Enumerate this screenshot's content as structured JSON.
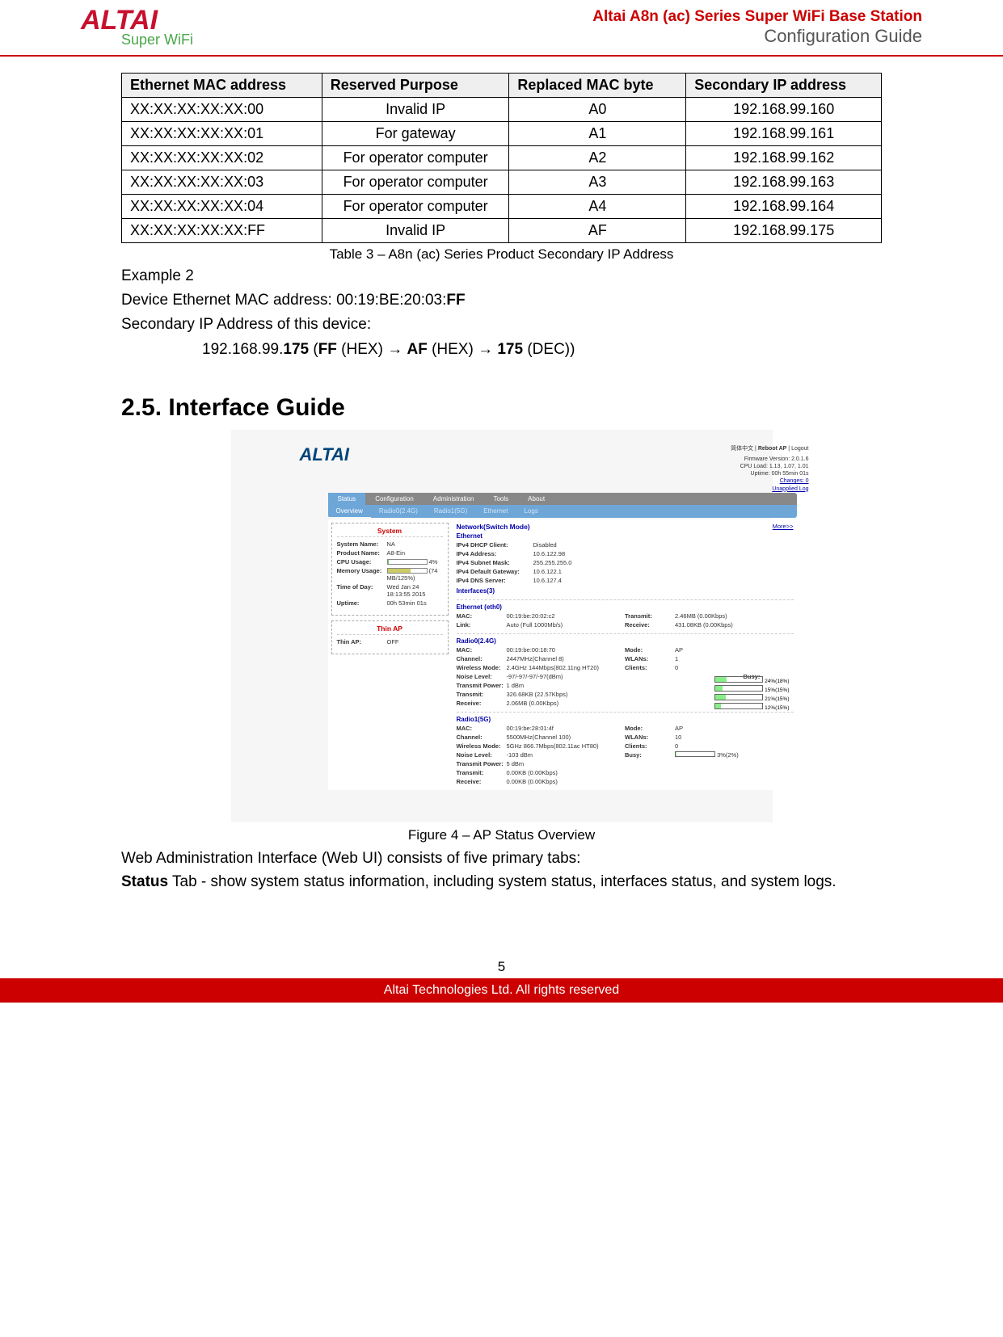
{
  "header": {
    "logo_text": "ALTAI",
    "logo_sub": "Super WiFi",
    "title_line1": "Altai A8n (ac) Series Super WiFi Base Station",
    "title_line2": "Configuration Guide"
  },
  "table3": {
    "headers": [
      "Ethernet MAC address",
      "Reserved Purpose",
      "Replaced MAC byte",
      "Secondary IP address"
    ],
    "rows": [
      {
        "mac": "XX:XX:XX:XX:XX:00",
        "purpose": "Invalid IP",
        "byte": "A0",
        "ip": "192.168.99.160"
      },
      {
        "mac": "XX:XX:XX:XX:XX:01",
        "purpose": "For gateway",
        "byte": "A1",
        "ip": "192.168.99.161"
      },
      {
        "mac": "XX:XX:XX:XX:XX:02",
        "purpose": "For operator computer",
        "byte": "A2",
        "ip": "192.168.99.162"
      },
      {
        "mac": "XX:XX:XX:XX:XX:03",
        "purpose": "For operator computer",
        "byte": "A3",
        "ip": "192.168.99.163"
      },
      {
        "mac": "XX:XX:XX:XX:XX:04",
        "purpose": "For operator computer",
        "byte": "A4",
        "ip": "192.168.99.164"
      },
      {
        "mac": "XX:XX:XX:XX:XX:FF",
        "purpose": "Invalid IP",
        "byte": "AF",
        "ip": "192.168.99.175"
      }
    ],
    "caption": "Table 3 – A8n (ac) Series Product Secondary IP Address"
  },
  "example2": {
    "heading": "Example 2",
    "line1_a": "Device Ethernet MAC address: 00:19:BE:20:03:",
    "line1_b": "FF",
    "line2": "Secondary IP Address of this device:",
    "formula_a": "192.168.99.",
    "formula_b": "175",
    "formula_c": " (",
    "formula_d": "FF",
    "formula_e": " (HEX) ",
    "formula_f": "AF",
    "formula_g": " (HEX) ",
    "formula_h": "175",
    "formula_i": " (DEC))"
  },
  "section_heading": "2.5.  Interface Guide",
  "figure": {
    "logo": "ALTAI",
    "top_links": {
      "lang": "简体中文",
      "reboot": "Reboot AP",
      "logout": "Logout"
    },
    "sysinfo": {
      "fw": "Firmware Version: 2.0.1.6",
      "cpu": "CPU Load: 1.13, 1.07, 1.01",
      "uptime": "Uptime: 00h 55min 01s",
      "changes": "Changes: 0",
      "unsaved": "Unapplied Log"
    },
    "nav": [
      "Status",
      "Configuration",
      "Administration",
      "Tools",
      "About"
    ],
    "subnav": [
      "Overview",
      "Radio0(2.4G)",
      "Radio1(5G)",
      "Ethernet",
      "Logs"
    ],
    "system_panel": {
      "title": "System",
      "system_name_lab": "System Name:",
      "system_name": "NA",
      "product_name_lab": "Product Name:",
      "product_name": "A8-Ein",
      "cpu_lab": "CPU Usage:",
      "cpu": "4%",
      "mem_lab": "Memory Usage:",
      "mem": "59%",
      "mem_raw": "(74 MB/125%)",
      "tod_lab": "Time of Day:",
      "tod": "Wed Jan 24 18:13:55 2015",
      "up_lab": "Uptime:",
      "up": "00h 53min 01s"
    },
    "thinap_panel": {
      "title": "Thin AP",
      "thinap_lab": "Thin AP:",
      "thinap": "OFF"
    },
    "network": {
      "title": "Network(Switch Mode)",
      "more": "More>>",
      "eth_title": "Ethernet",
      "dhcp_lab": "IPv4 DHCP Client:",
      "dhcp": "Disabled",
      "ip_lab": "IPv4 Address:",
      "ip": "10.6.122.98",
      "mask_lab": "IPv4 Subnet Mask:",
      "mask": "255.255.255.0",
      "gw_lab": "IPv4 Default Gateway:",
      "gw": "10.6.122.1",
      "dns_lab": "IPv4 DNS Server:",
      "dns": "10.6.127.4",
      "if_title": "Interfaces(3)"
    },
    "eth0": {
      "title": "Ethernet (eth0)",
      "mac_lab": "MAC:",
      "mac": "00:19:be:20:02:c2",
      "tx_lab": "Transmit:",
      "tx": "2.46MB (0.00Kbps)",
      "link_lab": "Link:",
      "link": "Auto (Full 1000Mb/s)",
      "rx_lab": "Receive:",
      "rx": "431.08KB (0.00Kbps)"
    },
    "r24": {
      "title": "Radio0(2.4G)",
      "mac_lab": "MAC:",
      "mac": "00:19:be:00:18:70",
      "mode_lab": "Mode:",
      "mode": "AP",
      "ch_lab": "Channel:",
      "ch": "2447MHz(Channel 8)",
      "wlan_lab": "WLANs:",
      "wlan": "1",
      "wm_lab": "Wireless Mode:",
      "wm": "2.4GHz 144Mbps(802.11ng HT20)",
      "cl_lab": "Clients:",
      "cl": "0",
      "nl_lab": "Noise Level:",
      "nl": "-97/-97/-97/-97(dBm)",
      "busy_lab": "Busy:",
      "tp_lab": "Transmit Power:",
      "tp": "1 dBm",
      "tx_lab": "Transmit:",
      "tx": "326.68KB (22.57Kbps)",
      "rx_lab": "Receive:",
      "rx": "2.06MB (0.00Kbps)",
      "busy_bars": [
        "24%(18%)",
        "15%(15%)",
        "21%(15%)",
        "12%(15%)"
      ]
    },
    "r5": {
      "title": "Radio1(5G)",
      "mac_lab": "MAC:",
      "mac": "00:19:be:28:01:4f",
      "mode_lab": "Mode:",
      "mode": "AP",
      "ch_lab": "Channel:",
      "ch": "5500MHz(Channel 100)",
      "wlan_lab": "WLANs:",
      "wlan": "10",
      "wm_lab": "Wireless Mode:",
      "wm": "5GHz 866.7Mbps(802.11ac HT80)",
      "cl_lab": "Clients:",
      "cl": "0",
      "nl_lab": "Noise Level:",
      "nl": "-103 dBm",
      "busy_lab": "Busy:",
      "busy_bar": "3%(2%)",
      "tp_lab": "Transmit Power:",
      "tp": "5 dBm",
      "tx_lab": "Transmit:",
      "tx": "0.00KB (0.00Kbps)",
      "rx_lab": "Receive:",
      "rx": "0.00KB (0.00Kbps)"
    },
    "caption": "Figure 4 – AP Status Overview"
  },
  "body": {
    "p1": "Web Administration Interface (Web UI) consists of five primary tabs:",
    "p2_bold": "Status",
    "p2": " Tab - show system status information, including system status, interfaces status, and system logs."
  },
  "page_number": "5",
  "footer": "Altai Technologies Ltd. All rights reserved"
}
